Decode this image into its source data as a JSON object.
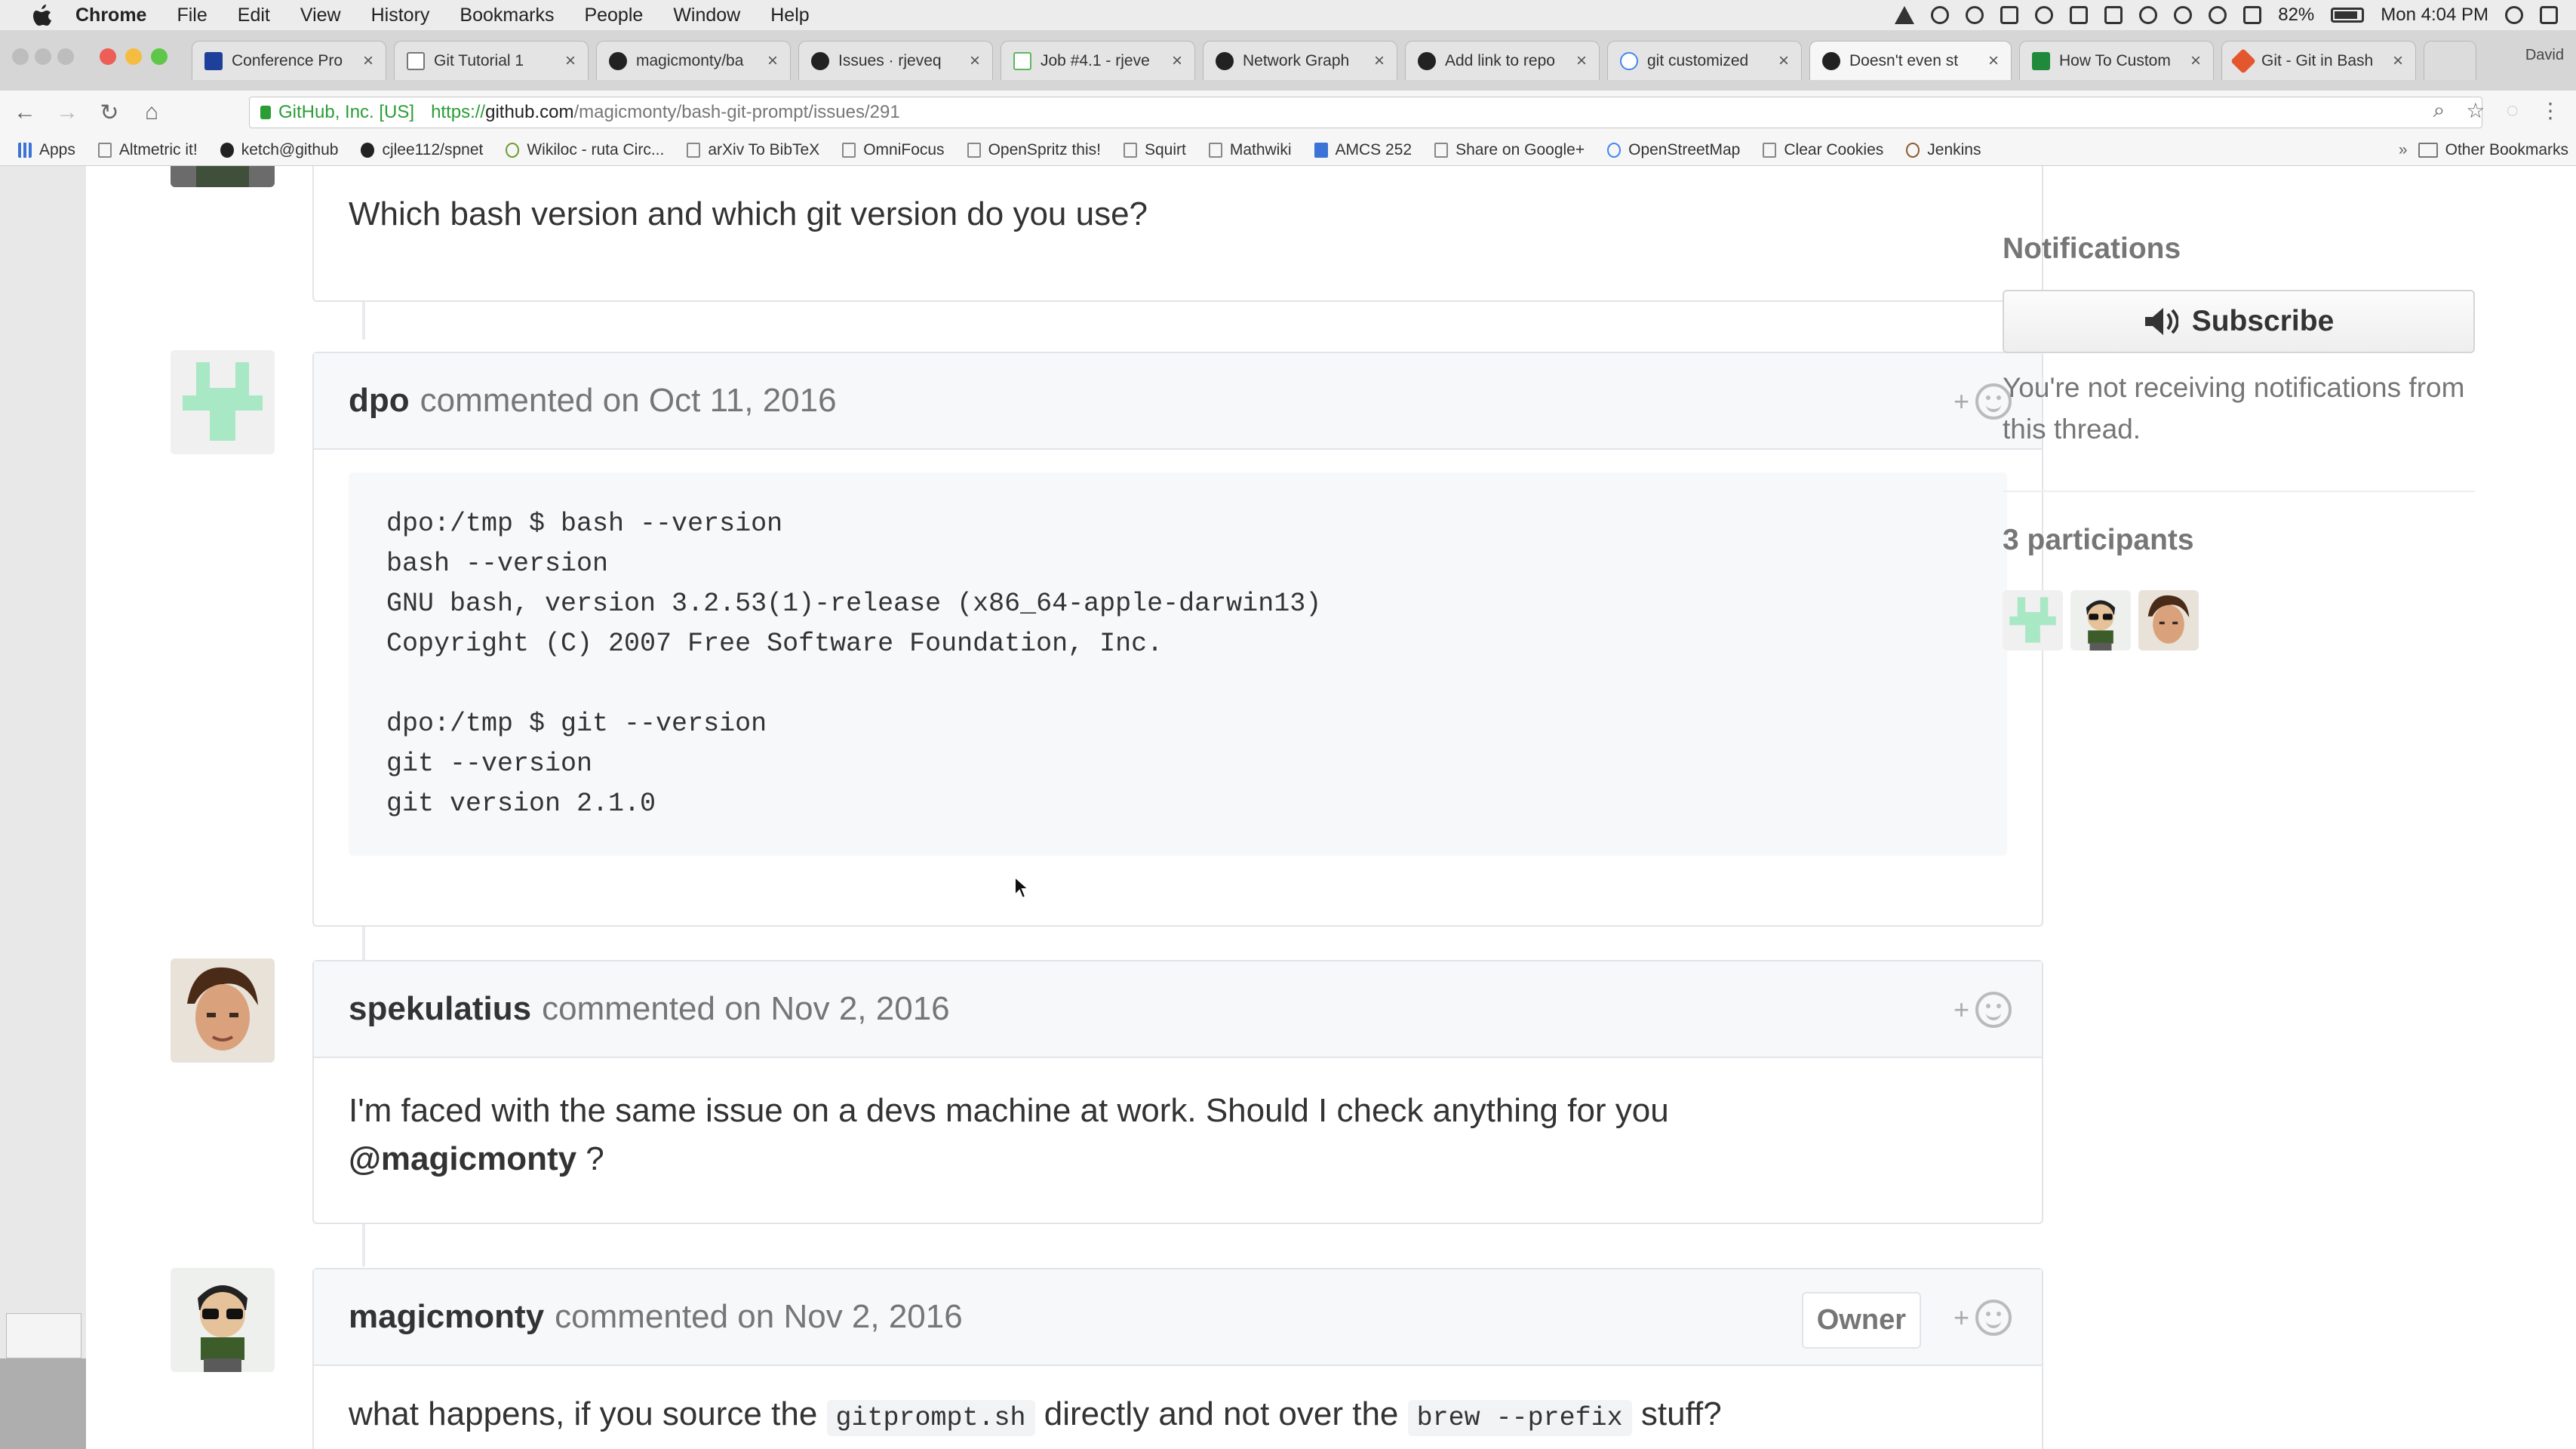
{
  "menubar": {
    "app": "Chrome",
    "items": [
      "File",
      "Edit",
      "View",
      "History",
      "Bookmarks",
      "People",
      "Window",
      "Help"
    ],
    "battery": "82%",
    "clock": "Mon 4:04 PM"
  },
  "tabs": [
    {
      "label": "Conference Pro"
    },
    {
      "label": "Git Tutorial 1"
    },
    {
      "label": "magicmonty/ba"
    },
    {
      "label": "Issues · rjeveq"
    },
    {
      "label": "Job #4.1 - rjeve"
    },
    {
      "label": "Network Graph"
    },
    {
      "label": "Add link to repo"
    },
    {
      "label": "git customized"
    },
    {
      "label": "Doesn't even st"
    },
    {
      "label": "How To Custom"
    },
    {
      "label": "Git - Git in Bash"
    }
  ],
  "profile": "David",
  "address": {
    "org": "GitHub, Inc. [US]",
    "scheme": "https://",
    "host": "github.com",
    "path": "/magicmonty/bash-git-prompt/issues/291"
  },
  "bookmarks": {
    "items": [
      "Apps",
      "Altmetric it!",
      "ketch@github",
      "cjlee112/spnet",
      "Wikiloc - ruta Circ...",
      "arXiv To BibTeX",
      "OmniFocus",
      "OpenSpritz this!",
      "Squirt",
      "Mathwiki",
      "AMCS 252",
      "Share on Google+",
      "OpenStreetMap",
      "Clear Cookies",
      "Jenkins"
    ],
    "other": "Other Bookmarks"
  },
  "comments": {
    "prev_body": "Which bash version and which git version do you use?",
    "dpo": {
      "author": "dpo",
      "meta": "commented on Oct 11, 2016",
      "code_lines": [
        "dpo:/tmp $ bash --version",
        "bash --version",
        "GNU bash, version 3.2.53(1)-release (x86_64-apple-darwin13)",
        "Copyright (C) 2007 Free Software Foundation, Inc.",
        "",
        "dpo:/tmp $ git --version",
        "git --version",
        "git version 2.1.0"
      ]
    },
    "spekulatius": {
      "author": "spekulatius",
      "meta": "commented on Nov 2, 2016",
      "body": "I'm faced with the same issue on a devs machine at work. Should I check anything for you",
      "mention": "@magicmonty",
      "after_mention": " ?"
    },
    "magicmonty": {
      "author": "magicmonty",
      "meta": "commented on Nov 2, 2016",
      "badge": "Owner",
      "body_a": "what happens, if you source the ",
      "code_a": "gitprompt.sh",
      "body_b": " directly and not over the ",
      "code_b": "brew --prefix",
      "body_c": " stuff?"
    }
  },
  "sidebar": {
    "notifications_heading": "Notifications",
    "subscribe_label": "Subscribe",
    "note": "You're not receiving notifications from this thread.",
    "participants_heading": "3 participants"
  },
  "reaction_plus": "+",
  "colors": {
    "identicon": "#a8e8c4",
    "link_green": "#2a9d35",
    "muted_text": "#767676"
  }
}
